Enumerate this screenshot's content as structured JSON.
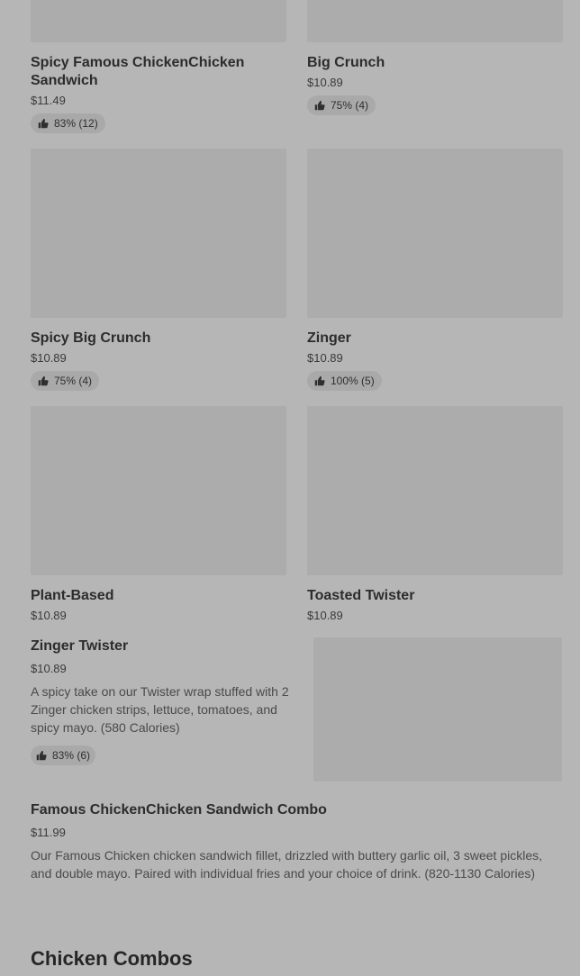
{
  "items": [
    {
      "name": "Spicy Famous ChickenChicken Sandwich",
      "price": "$11.49",
      "rating": "83% (12)"
    },
    {
      "name": "Big Crunch",
      "price": "$10.89",
      "rating": "75% (4)"
    },
    {
      "name": "Spicy Big Crunch",
      "price": "$10.89",
      "rating": "75% (4)"
    },
    {
      "name": "Zinger",
      "price": "$10.89",
      "rating": "100% (5)"
    },
    {
      "name": "Plant-Based",
      "price": "$10.89"
    },
    {
      "name": "Toasted Twister",
      "price": "$10.89"
    }
  ],
  "featured": [
    {
      "name": "Zinger Twister",
      "price": "$10.89",
      "description": "A spicy take on our Twister wrap stuffed with 2 Zinger chicken strips, lettuce, tomatoes, and spicy mayo. (580 Calories)",
      "rating": "83% (6)"
    },
    {
      "name": "Famous ChickenChicken Sandwich Combo",
      "price": "$11.99",
      "description": "Our Famous Chicken chicken sandwich fillet, drizzled with buttery garlic oil, 3 sweet pickles, and double mayo. Paired with individual fries and your choice of drink. (820-1130 Calories)"
    }
  ],
  "section": {
    "title": "Chicken Combos"
  },
  "colors": {
    "overlay": "#b6b6b6",
    "image_placeholder": "#acacac"
  }
}
